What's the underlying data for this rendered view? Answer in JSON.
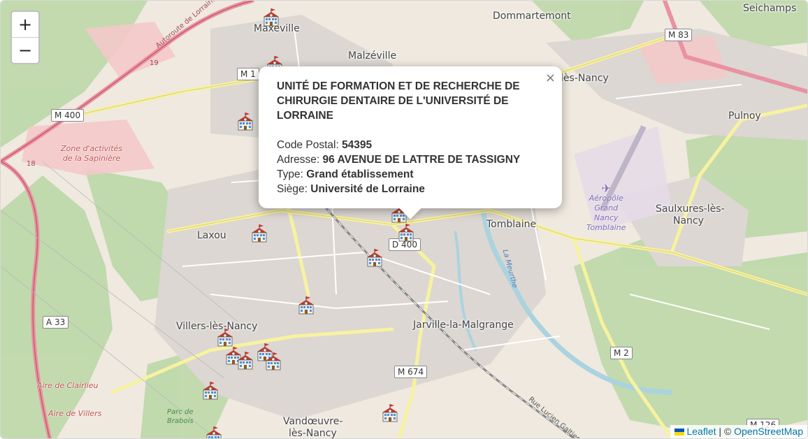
{
  "zoom": {
    "in_label": "+",
    "out_label": "−"
  },
  "popup": {
    "close_label": "×",
    "title": "UNITÉ DE FORMATION ET DE RECHERCHE DE CHIRURGIE DENTAIRE DE L'UNIVERSITÉ DE LORRAINE",
    "postal_label": "Code Postal:",
    "postal_value": "54395",
    "address_label": "Adresse:",
    "address_value": "96 AVENUE DE LATTRE DE TASSIGNY",
    "type_label": "Type:",
    "type_value": "Grand établissement",
    "siege_label": "Siège:",
    "siege_value": "Université de Lorraine"
  },
  "attribution": {
    "leaflet": "Leaflet",
    "separator": " | © ",
    "osm": "OpenStreetMap"
  },
  "places": {
    "maxeville": "Maxéville",
    "malzeville": "Malzéville",
    "dommartemont": "Dommartemont",
    "seichamps": "Seichamps",
    "les_nancy": "lès-Nancy",
    "pulnoy": "Pulnoy",
    "laxou": "Laxou",
    "tomblaine": "Tomblaine",
    "saulxures_1": "Saulxures-lès-",
    "saulxures_2": "Nancy",
    "villers": "Villers-lès-Nancy",
    "jarville": "Jarville-la-Malgrange",
    "vandoeuvre_1": "Vandœuvre-",
    "vandoeuvre_2": "lès-Nancy"
  },
  "areas": {
    "zone_1": "Zone d'activités",
    "zone_2": "de la Sapinière",
    "airport_1": "Aéropôle",
    "airport_2": "Grand",
    "airport_3": "Nancy",
    "airport_4": "Tomblaine",
    "aire_clairlieu": "Aire de Clairlieu",
    "aire_villers": "Aire de Villers",
    "park_1": "Parc de",
    "park_2": "Brabois",
    "canal": "La Meurthe",
    "autoroute": "Autoroute de Lorraine-Bourgogne",
    "rue_lucien": "Rue Lucien Galtier"
  },
  "roads": {
    "m83": "M 83",
    "m1": "M 1",
    "m400": "M 400",
    "d400": "D 400",
    "a33": "A 33",
    "m674": "M 674",
    "m2": "M 2",
    "m126": "M 126",
    "r19": "19",
    "r18": "18"
  },
  "marker_icon": "school-building-icon"
}
